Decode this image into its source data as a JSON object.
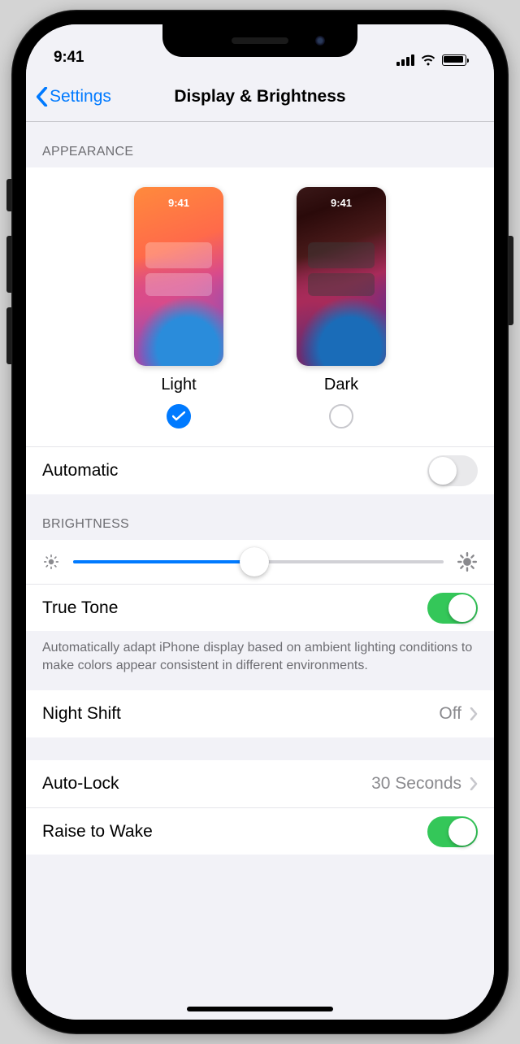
{
  "status_bar": {
    "time": "9:41"
  },
  "nav": {
    "back_label": "Settings",
    "title": "Display & Brightness"
  },
  "appearance": {
    "header": "APPEARANCE",
    "options": [
      {
        "label": "Light",
        "thumb_time": "9:41",
        "selected": true
      },
      {
        "label": "Dark",
        "thumb_time": "9:41",
        "selected": false
      }
    ],
    "automatic": {
      "label": "Automatic",
      "on": false
    }
  },
  "brightness": {
    "header": "BRIGHTNESS",
    "slider_percent": 49,
    "true_tone": {
      "label": "True Tone",
      "on": true
    },
    "footer": "Automatically adapt iPhone display based on ambient lighting conditions to make colors appear consistent in different environments."
  },
  "night_shift": {
    "label": "Night Shift",
    "value": "Off"
  },
  "auto_lock": {
    "label": "Auto-Lock",
    "value": "30 Seconds"
  },
  "raise_to_wake": {
    "label": "Raise to Wake",
    "on": true
  }
}
